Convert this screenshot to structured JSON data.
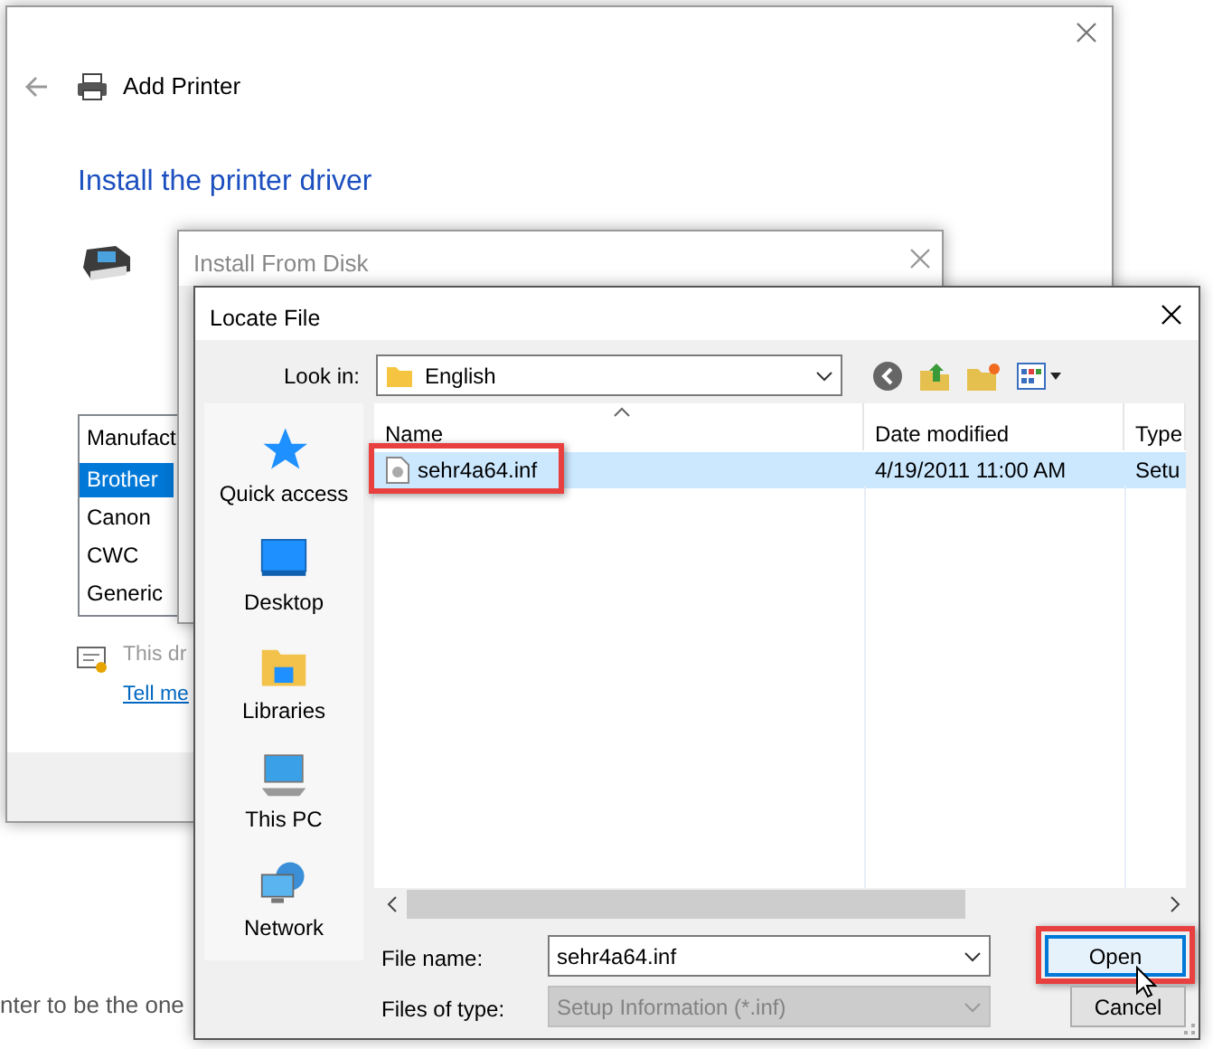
{
  "add_printer": {
    "title": "Add Printer",
    "heading": "Install the printer driver",
    "manufacturers": {
      "header": "Manufact",
      "items": [
        {
          "label": "Brother",
          "selected": true
        },
        {
          "label": "Canon",
          "selected": false
        },
        {
          "label": "CWC",
          "selected": false
        },
        {
          "label": "Generic",
          "selected": false
        }
      ]
    },
    "note": "This dr",
    "link": "Tell me"
  },
  "background_text": "nter to be the one",
  "install_from_disk": {
    "title": "Install From Disk"
  },
  "locate_file": {
    "title": "Locate File",
    "look_in": {
      "label": "Look in:",
      "value": "English"
    },
    "places": [
      {
        "label": "Quick access",
        "kind": "star"
      },
      {
        "label": "Desktop",
        "kind": "desktop"
      },
      {
        "label": "Libraries",
        "kind": "libraries"
      },
      {
        "label": "This PC",
        "kind": "pc"
      },
      {
        "label": "Network",
        "kind": "network"
      }
    ],
    "columns": [
      "Name",
      "Date modified",
      "Type"
    ],
    "files": [
      {
        "name": "sehr4a64.inf",
        "date": "4/19/2011 11:00 AM",
        "type": "Setu",
        "selected": true,
        "highlighted": true
      }
    ],
    "file_name": {
      "label": "File name:",
      "value": "sehr4a64.inf"
    },
    "file_type": {
      "label": "Files of type:",
      "value": "Setup Information (*.inf)",
      "disabled": true
    },
    "buttons": [
      {
        "label": "Open",
        "highlighted": true,
        "focused": true
      },
      {
        "label": "Cancel",
        "highlighted": false,
        "focused": false
      }
    ]
  }
}
